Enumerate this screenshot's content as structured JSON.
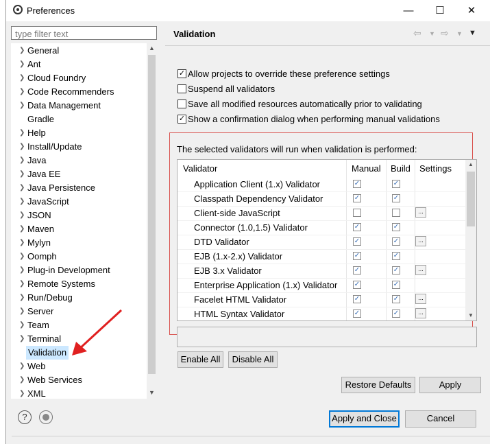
{
  "window": {
    "title": "Preferences"
  },
  "filter": {
    "placeholder": "type filter text"
  },
  "tree": {
    "items": [
      {
        "label": "General",
        "expandable": true
      },
      {
        "label": "Ant",
        "expandable": true
      },
      {
        "label": "Cloud Foundry",
        "expandable": true
      },
      {
        "label": "Code Recommenders",
        "expandable": true
      },
      {
        "label": "Data Management",
        "expandable": true
      },
      {
        "label": "Gradle",
        "expandable": false
      },
      {
        "label": "Help",
        "expandable": true
      },
      {
        "label": "Install/Update",
        "expandable": true
      },
      {
        "label": "Java",
        "expandable": true
      },
      {
        "label": "Java EE",
        "expandable": true
      },
      {
        "label": "Java Persistence",
        "expandable": true
      },
      {
        "label": "JavaScript",
        "expandable": true
      },
      {
        "label": "JSON",
        "expandable": true
      },
      {
        "label": "Maven",
        "expandable": true
      },
      {
        "label": "Mylyn",
        "expandable": true
      },
      {
        "label": "Oomph",
        "expandable": true
      },
      {
        "label": "Plug-in Development",
        "expandable": true
      },
      {
        "label": "Remote Systems",
        "expandable": true
      },
      {
        "label": "Run/Debug",
        "expandable": true
      },
      {
        "label": "Server",
        "expandable": true
      },
      {
        "label": "Team",
        "expandable": true
      },
      {
        "label": "Terminal",
        "expandable": true
      },
      {
        "label": "Validation",
        "expandable": false,
        "selected": true
      },
      {
        "label": "Web",
        "expandable": true
      },
      {
        "label": "Web Services",
        "expandable": true
      },
      {
        "label": "XML",
        "expandable": true
      }
    ]
  },
  "panel": {
    "title": "Validation",
    "options": [
      {
        "label": "Allow projects to override these preference settings",
        "checked": true
      },
      {
        "label": "Suspend all validators",
        "checked": false
      },
      {
        "label": "Save all modified resources automatically prior to validating",
        "checked": false
      },
      {
        "label": "Show a confirmation dialog when performing manual validations",
        "checked": true
      }
    ],
    "selected_note": "The selected validators will run when validation is performed:",
    "table": {
      "headers": [
        "Validator",
        "Manual",
        "Build",
        "Settings"
      ],
      "rows": [
        {
          "name": "Application Client (1.x) Validator",
          "manual": true,
          "build": true,
          "settings": false
        },
        {
          "name": "Classpath Dependency Validator",
          "manual": true,
          "build": true,
          "settings": false
        },
        {
          "name": "Client-side JavaScript",
          "manual": false,
          "build": false,
          "settings": true
        },
        {
          "name": "Connector (1.0,1.5) Validator",
          "manual": true,
          "build": true,
          "settings": false
        },
        {
          "name": "DTD Validator",
          "manual": true,
          "build": true,
          "settings": true
        },
        {
          "name": "EJB (1.x-2.x) Validator",
          "manual": true,
          "build": true,
          "settings": false
        },
        {
          "name": "EJB 3.x Validator",
          "manual": true,
          "build": true,
          "settings": true
        },
        {
          "name": "Enterprise Application (1.x) Validator",
          "manual": true,
          "build": true,
          "settings": false
        },
        {
          "name": "Facelet HTML Validator",
          "manual": true,
          "build": true,
          "settings": true
        },
        {
          "name": "HTML Syntax Validator",
          "manual": true,
          "build": true,
          "settings": true
        }
      ],
      "settings_button": "..."
    },
    "enable_all": "Enable All",
    "disable_all": "Disable All",
    "restore_defaults": "Restore Defaults",
    "apply": "Apply"
  },
  "footer": {
    "apply_and_close": "Apply and Close",
    "cancel": "Cancel",
    "help_glyph": "?"
  },
  "colors": {
    "selection": "#cce8ff",
    "highlight_box": "#d9534f",
    "accent": "#0078d7"
  }
}
